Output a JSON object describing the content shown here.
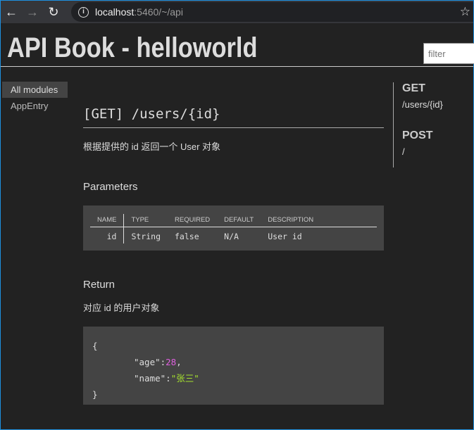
{
  "browser": {
    "host": "localhost",
    "path": ":5460/~/api"
  },
  "header": {
    "title": "API Book - helloworld",
    "filter_placeholder": "filter"
  },
  "sidebar": {
    "items": [
      {
        "label": "All modules"
      },
      {
        "label": "AppEntry"
      }
    ]
  },
  "main": {
    "endpoint": "[GET] /users/{id}",
    "description": "根据提供的 id 返回一个 User 对象",
    "parameters_title": "Parameters",
    "columns": [
      "NAME",
      "TYPE",
      "REQUIRED",
      "DEFAULT",
      "DESCRIPTION"
    ],
    "rows": [
      [
        "id",
        "String",
        "false",
        "N/A",
        "User id"
      ]
    ],
    "return_title": "Return",
    "return_desc": "对应 id 的用户对象",
    "code": {
      "open": "{",
      "age_key": "\"age\":",
      "age_val": "28",
      "comma": ",",
      "name_key": "\"name\":",
      "name_val": "\"张三\"",
      "close": "}"
    }
  },
  "toc": {
    "get_title": "GET",
    "get_items": [
      "/users/{id}"
    ],
    "post_title": "POST",
    "post_items": [
      "/"
    ]
  }
}
